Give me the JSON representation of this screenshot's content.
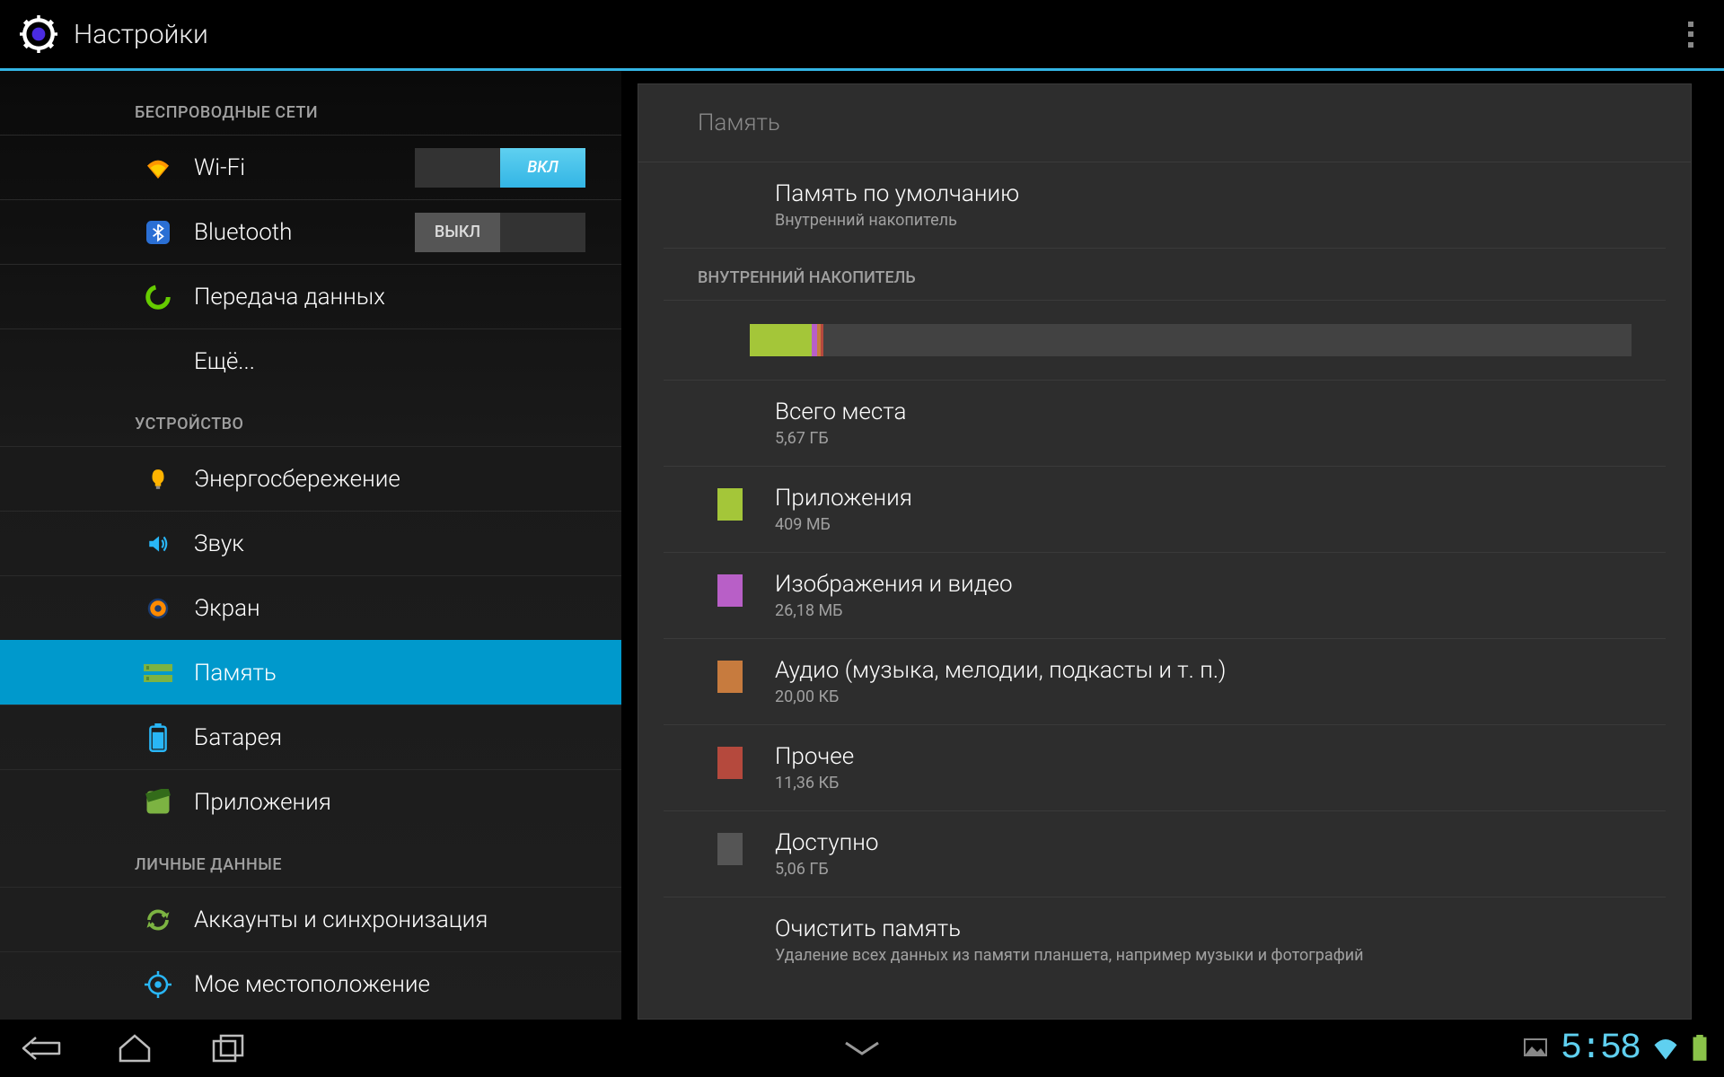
{
  "header": {
    "title": "Настройки"
  },
  "sidebar": {
    "cat_wireless": "БЕСПРОВОДНЫЕ СЕТИ",
    "cat_device": "УСТРОЙСТВО",
    "cat_personal": "ЛИЧНЫЕ ДАННЫЕ",
    "wifi": {
      "label": "Wi-Fi",
      "toggle_on": "ВКЛ"
    },
    "bt": {
      "label": "Bluetooth",
      "toggle_off": "ВЫКЛ"
    },
    "data": {
      "label": "Передача данных"
    },
    "more": {
      "label": "Ещё..."
    },
    "power": {
      "label": "Энергосбережение"
    },
    "sound": {
      "label": "Звук"
    },
    "display": {
      "label": "Экран"
    },
    "storage": {
      "label": "Память"
    },
    "battery": {
      "label": "Батарея"
    },
    "apps": {
      "label": "Приложения"
    },
    "accounts": {
      "label": "Аккаунты и синхронизация"
    },
    "location": {
      "label": "Мое местоположение"
    }
  },
  "panel": {
    "breadcrumb": "Память",
    "default_title": "Память по умолчанию",
    "default_sub": "Внутренний накопитель",
    "section": "ВНУТРЕННИЙ НАКОПИТЕЛЬ",
    "total_title": "Всего места",
    "total_value": "5,67  ГБ",
    "apps_title": "Приложения",
    "apps_value": "409  МБ",
    "pics_title": "Изображения и видео",
    "pics_value": "26,18  МБ",
    "audio_title": "Аудио (музыка, мелодии, подкасты и т. п.)",
    "audio_value": "20,00  КБ",
    "misc_title": "Прочее",
    "misc_value": "11,36  КБ",
    "avail_title": "Доступно",
    "avail_value": "5,06  ГБ",
    "erase_title": "Очистить память",
    "erase_sub": "Удаление всех данных из памяти планшета, например музыки и фотографий"
  },
  "colors": {
    "apps": "#a4c639",
    "pics": "#b85fc7",
    "audio": "#c77b3e",
    "misc": "#b5493d",
    "avail": "#555"
  },
  "bar_pct": {
    "apps": 7.0,
    "pics": 0.6,
    "audio": 0.4,
    "misc": 0.4
  },
  "statusbar": {
    "clock": "5:58"
  }
}
